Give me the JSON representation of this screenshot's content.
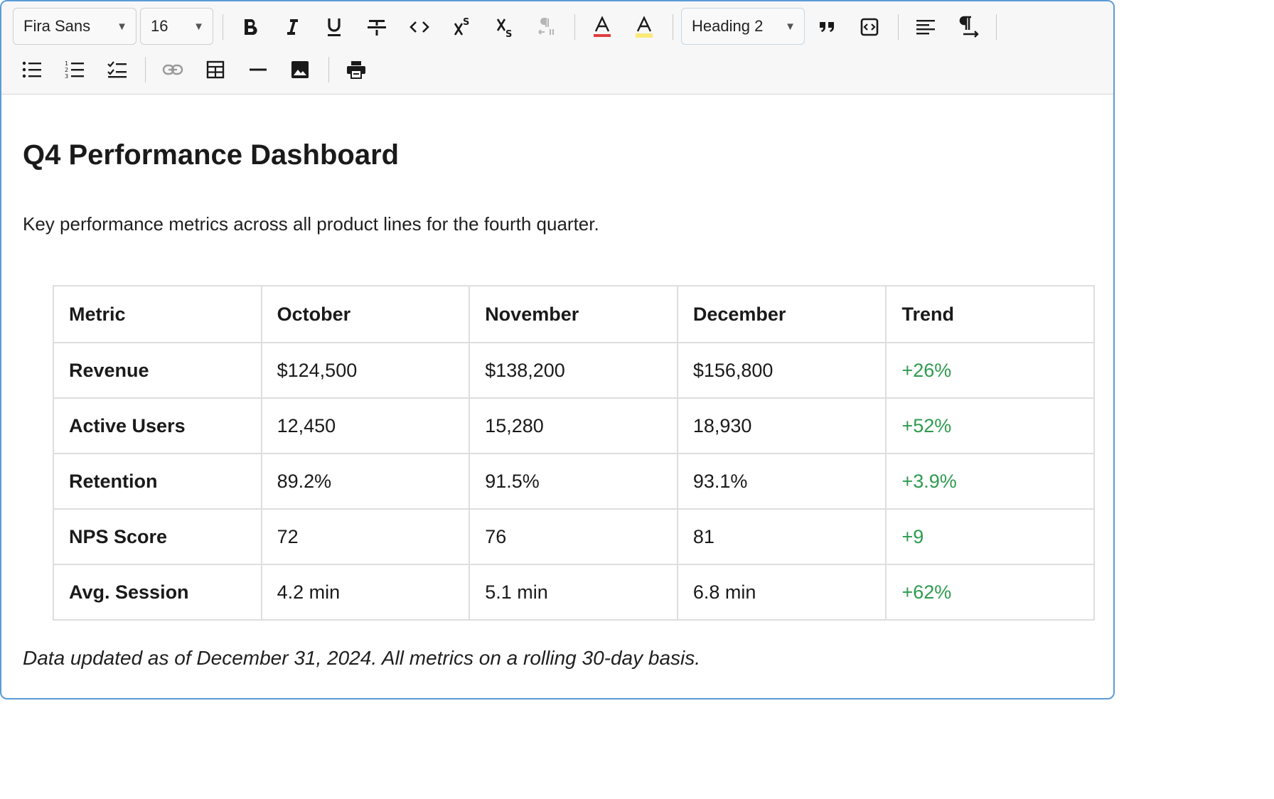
{
  "toolbar": {
    "font_family": "Fira Sans",
    "font_size": "16",
    "block_format": "Heading 2",
    "icons": [
      "bold-icon",
      "italic-icon",
      "underline-icon",
      "strikethrough-icon",
      "code-icon",
      "superscript-icon",
      "subscript-icon",
      "clear-format-icon",
      "text-color-icon",
      "highlight-color-icon",
      "blockquote-icon",
      "code-block-icon",
      "align-left-icon",
      "text-direction-icon",
      "bullet-list-icon",
      "ordered-list-icon",
      "checklist-icon",
      "link-icon",
      "table-icon",
      "horizontal-rule-icon",
      "image-icon",
      "print-icon"
    ],
    "text_color": "#e03e3e",
    "highlight_color": "#fbe978"
  },
  "document": {
    "title": "Q4 Performance Dashboard",
    "lead": "Key performance metrics across all product lines for the fourth quarter.",
    "table": {
      "headers": [
        "Metric",
        "October",
        "November",
        "December",
        "Trend"
      ],
      "rows": [
        [
          "Revenue",
          "$124,500",
          "$138,200",
          "$156,800",
          "+26%"
        ],
        [
          "Active Users",
          "12,450",
          "15,280",
          "18,930",
          "+52%"
        ],
        [
          "Retention",
          "89.2%",
          "91.5%",
          "93.1%",
          "+3.9%"
        ],
        [
          "NPS Score",
          "72",
          "76",
          "81",
          "+9"
        ],
        [
          "Avg. Session",
          "4.2 min",
          "5.1 min",
          "6.8 min",
          "+62%"
        ]
      ]
    },
    "footnote": "Data updated as of December 31, 2024. All metrics on a rolling 30-day basis."
  },
  "colors": {
    "border_accent": "#5a9bd8",
    "trend_positive": "#2e9a4f"
  }
}
